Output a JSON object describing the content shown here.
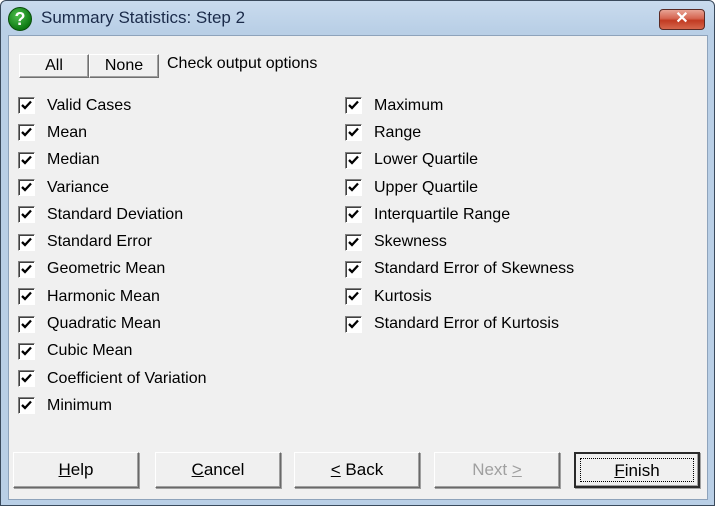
{
  "window": {
    "title": "Summary Statistics: Step 2",
    "icon": "help-question-icon",
    "close_label": "✕"
  },
  "toolbar": {
    "all_label": "All",
    "none_label": "None",
    "hint": "Check output options"
  },
  "options": {
    "left": [
      {
        "label": "Valid Cases",
        "checked": true
      },
      {
        "label": "Mean",
        "checked": true
      },
      {
        "label": "Median",
        "checked": true
      },
      {
        "label": "Variance",
        "checked": true
      },
      {
        "label": "Standard Deviation",
        "checked": true
      },
      {
        "label": "Standard Error",
        "checked": true
      },
      {
        "label": "Geometric Mean",
        "checked": true
      },
      {
        "label": "Harmonic Mean",
        "checked": true
      },
      {
        "label": "Quadratic Mean",
        "checked": true
      },
      {
        "label": "Cubic Mean",
        "checked": true
      },
      {
        "label": "Coefficient of Variation",
        "checked": true
      },
      {
        "label": "Minimum",
        "checked": true
      }
    ],
    "right": [
      {
        "label": "Maximum",
        "checked": true
      },
      {
        "label": "Range",
        "checked": true
      },
      {
        "label": "Lower Quartile",
        "checked": true
      },
      {
        "label": "Upper Quartile",
        "checked": true
      },
      {
        "label": "Interquartile Range",
        "checked": true
      },
      {
        "label": "Skewness",
        "checked": true
      },
      {
        "label": "Standard Error of Skewness",
        "checked": true
      },
      {
        "label": "Kurtosis",
        "checked": true
      },
      {
        "label": "Standard Error of Kurtosis",
        "checked": true
      }
    ]
  },
  "buttons": {
    "help": {
      "accel": "H",
      "rest": "elp"
    },
    "cancel": {
      "accel": "C",
      "rest": "ancel"
    },
    "back": {
      "accel": "<",
      "rest": " Back"
    },
    "next": {
      "label": "Next ",
      "accel": ">",
      "disabled": true
    },
    "finish": {
      "accel": "F",
      "rest": "inish",
      "default": true
    }
  }
}
